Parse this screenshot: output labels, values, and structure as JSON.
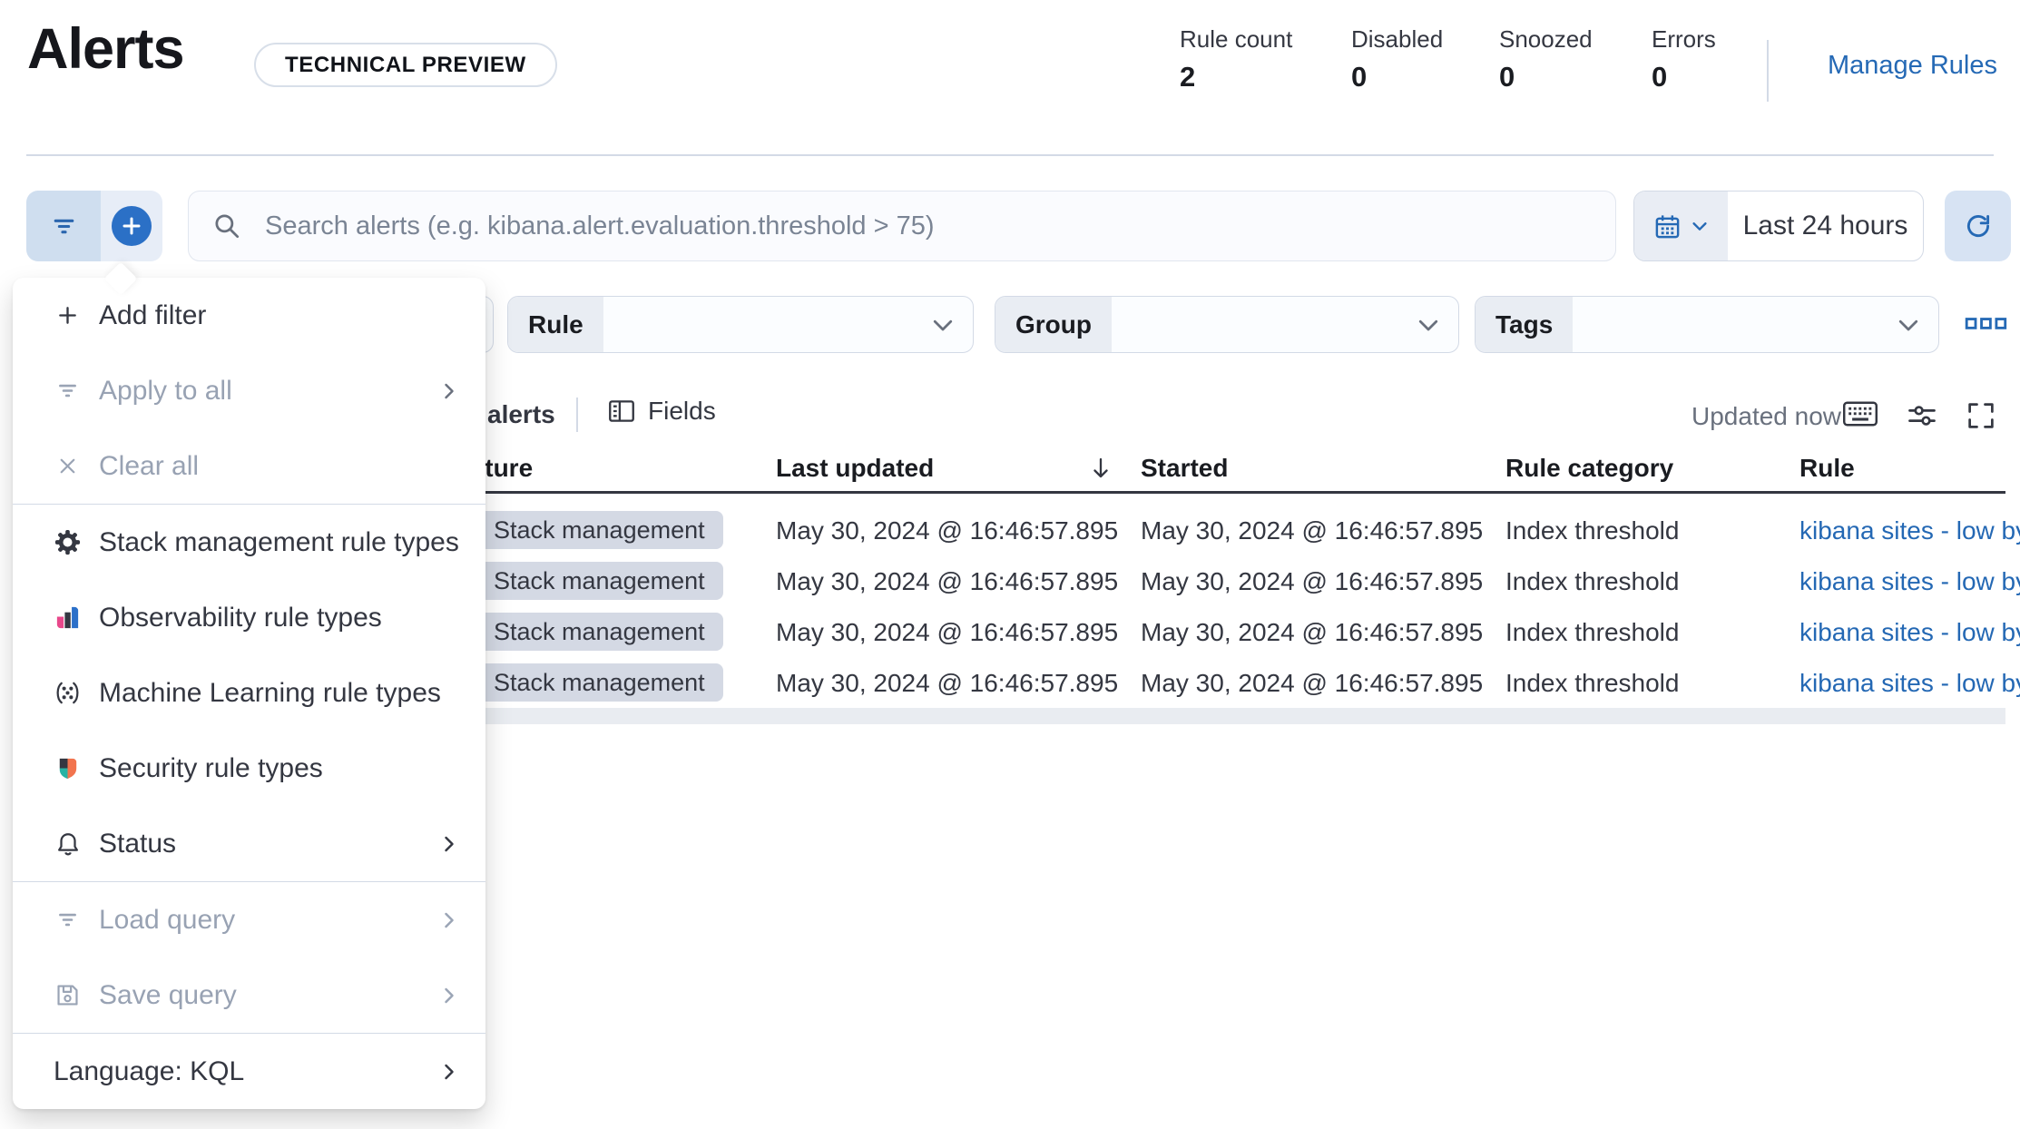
{
  "header": {
    "title": "Alerts",
    "tech_preview_badge": "TECHNICAL PREVIEW",
    "stats": [
      {
        "label": "Rule count",
        "value": "2"
      },
      {
        "label": "Disabled",
        "value": "0"
      },
      {
        "label": "Snoozed",
        "value": "0"
      },
      {
        "label": "Errors",
        "value": "0"
      }
    ],
    "manage_rules_link": "Manage Rules"
  },
  "search_bar": {
    "placeholder": "Search alerts (e.g. kibana.alert.evaluation.threshold > 75)",
    "time_range": "Last 24 hours"
  },
  "filter_row": {
    "rule_label": "Rule",
    "group_label": "Group",
    "tags_label": "Tags"
  },
  "filter_menu": {
    "items": [
      {
        "label": "Add filter"
      },
      {
        "label": "Apply to all"
      },
      {
        "label": "Clear all"
      },
      {
        "label": "Stack management rule types"
      },
      {
        "label": "Observability rule types"
      },
      {
        "label": "Machine Learning rule types"
      },
      {
        "label": "Security rule types"
      },
      {
        "label": "Status"
      },
      {
        "label": "Load query"
      },
      {
        "label": "Save query"
      },
      {
        "label": "Language: KQL"
      }
    ]
  },
  "toolbar": {
    "alerts_count_label": "alerts",
    "fields_button": "Fields",
    "updated_label": "Updated now"
  },
  "table": {
    "columns": [
      "Feature",
      "Last updated",
      "Started",
      "Rule category",
      "Rule"
    ],
    "rows": [
      {
        "feature": "Stack management",
        "last_updated": "May 30, 2024 @ 16:46:57.895",
        "started": "May 30, 2024 @ 16:46:57.895",
        "rule_category": "Index threshold",
        "rule": "kibana sites - low by"
      },
      {
        "feature": "Stack management",
        "last_updated": "May 30, 2024 @ 16:46:57.895",
        "started": "May 30, 2024 @ 16:46:57.895",
        "rule_category": "Index threshold",
        "rule": "kibana sites - low by"
      },
      {
        "feature": "Stack management",
        "last_updated": "May 30, 2024 @ 16:46:57.895",
        "started": "May 30, 2024 @ 16:46:57.895",
        "rule_category": "Index threshold",
        "rule": "kibana sites - low by"
      },
      {
        "feature": "Stack management",
        "last_updated": "May 30, 2024 @ 16:46:57.895",
        "started": "May 30, 2024 @ 16:46:57.895",
        "rule_category": "Index threshold",
        "rule": "kibana sites - low by"
      }
    ]
  },
  "icons": {
    "filter": "filter-funnel-icon",
    "plus": "plus-icon",
    "search": "search-icon",
    "calendar": "calendar-icon",
    "refresh": "refresh-icon",
    "gear": "gear-icon",
    "observability": "observability-logo-icon",
    "ml": "machine-learning-icon",
    "security": "security-logo-icon",
    "bell": "bell-icon",
    "save": "save-icon",
    "fields": "fields-columns-icon",
    "keyboard": "keyboard-icon",
    "controls": "controls-sliders-icon",
    "fullscreen": "fullscreen-icon",
    "sort_desc": "arrow-down-icon",
    "more": "boxes-horizontal-icon"
  },
  "colors": {
    "primary_blue": "#2569b5",
    "link_blue": "#2468b4",
    "text_dark": "#343741",
    "text_gray": "#69707d",
    "disabled_gray": "#98a2b3",
    "border_gray": "#d3dae6",
    "badge_bg": "#d4d9e4",
    "header_underline": "#343741"
  }
}
